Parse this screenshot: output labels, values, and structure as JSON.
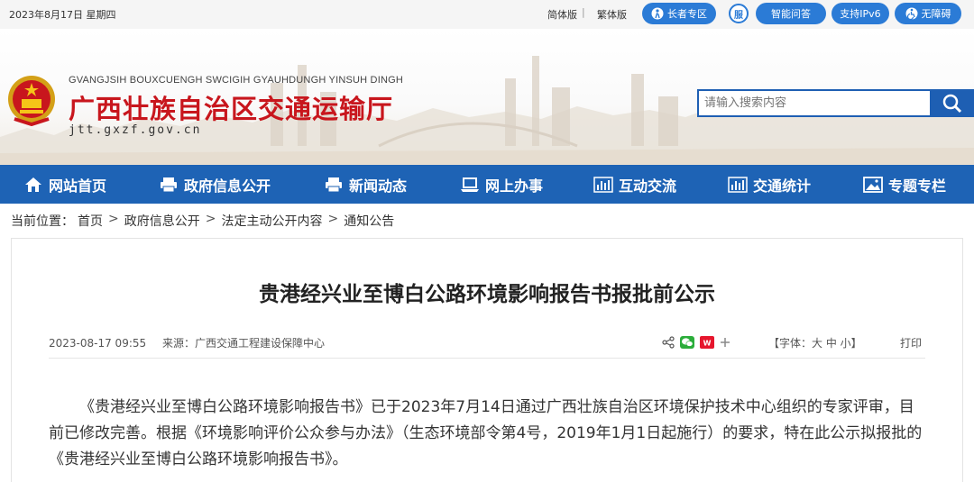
{
  "topbar": {
    "date": "2023年8月17日 星期四",
    "simplified": "简体版",
    "traditional": "繁体版",
    "elderly": "长者专区",
    "qa": "智能问答",
    "ipv6": "支持IPv6",
    "accessible": "无障碍",
    "accent": "#2b7bd6"
  },
  "header": {
    "pinyin": "GVANGJSIH BOUXCUENGH SWCIGIH GYAUHDUNGH YINSUH DINGH",
    "title": "广西壮族自治区交通运输厅",
    "domain": "jtt.gxzf.gov.cn",
    "search_placeholder": "请输入搜索内容",
    "title_color": "#c8161d"
  },
  "nav": {
    "color": "#1e63b5",
    "items": [
      {
        "label": "网站首页",
        "icon": "home-icon"
      },
      {
        "label": "政府信息公开",
        "icon": "printer-icon"
      },
      {
        "label": "新闻动态",
        "icon": "printer-icon"
      },
      {
        "label": "网上办事",
        "icon": "laptop-icon"
      },
      {
        "label": "互动交流",
        "icon": "bar-chart-icon"
      },
      {
        "label": "交通统计",
        "icon": "bar-chart-icon"
      },
      {
        "label": "专题专栏",
        "icon": "picture-icon"
      }
    ]
  },
  "breadcrumb": {
    "prefix": "当前位置：",
    "items": [
      "首页",
      "政府信息公开",
      "法定主动公开内容",
      "通知公告"
    ],
    "sep": ">"
  },
  "article": {
    "title": "贵港经兴业至博白公路环境影响报告书报批前公示",
    "datetime": "2023-08-17 09:55",
    "source": "来源：广西交通工程建设保障中心",
    "font_size_label": "【字体：大 中 小】",
    "print_label": "打印",
    "body": "《贵港经兴业至博白公路环境影响报告书》已于2023年7月14日通过广西壮族自治区环境保护技术中心组织的专家评审，目前已修改完善。根据《环境影响评价公众参与办法》（生态环境部令第4号，2019年1月1日起施行）的要求，特在此公示拟报批的《贵港经兴业至博白公路环境影响报告书》。"
  }
}
